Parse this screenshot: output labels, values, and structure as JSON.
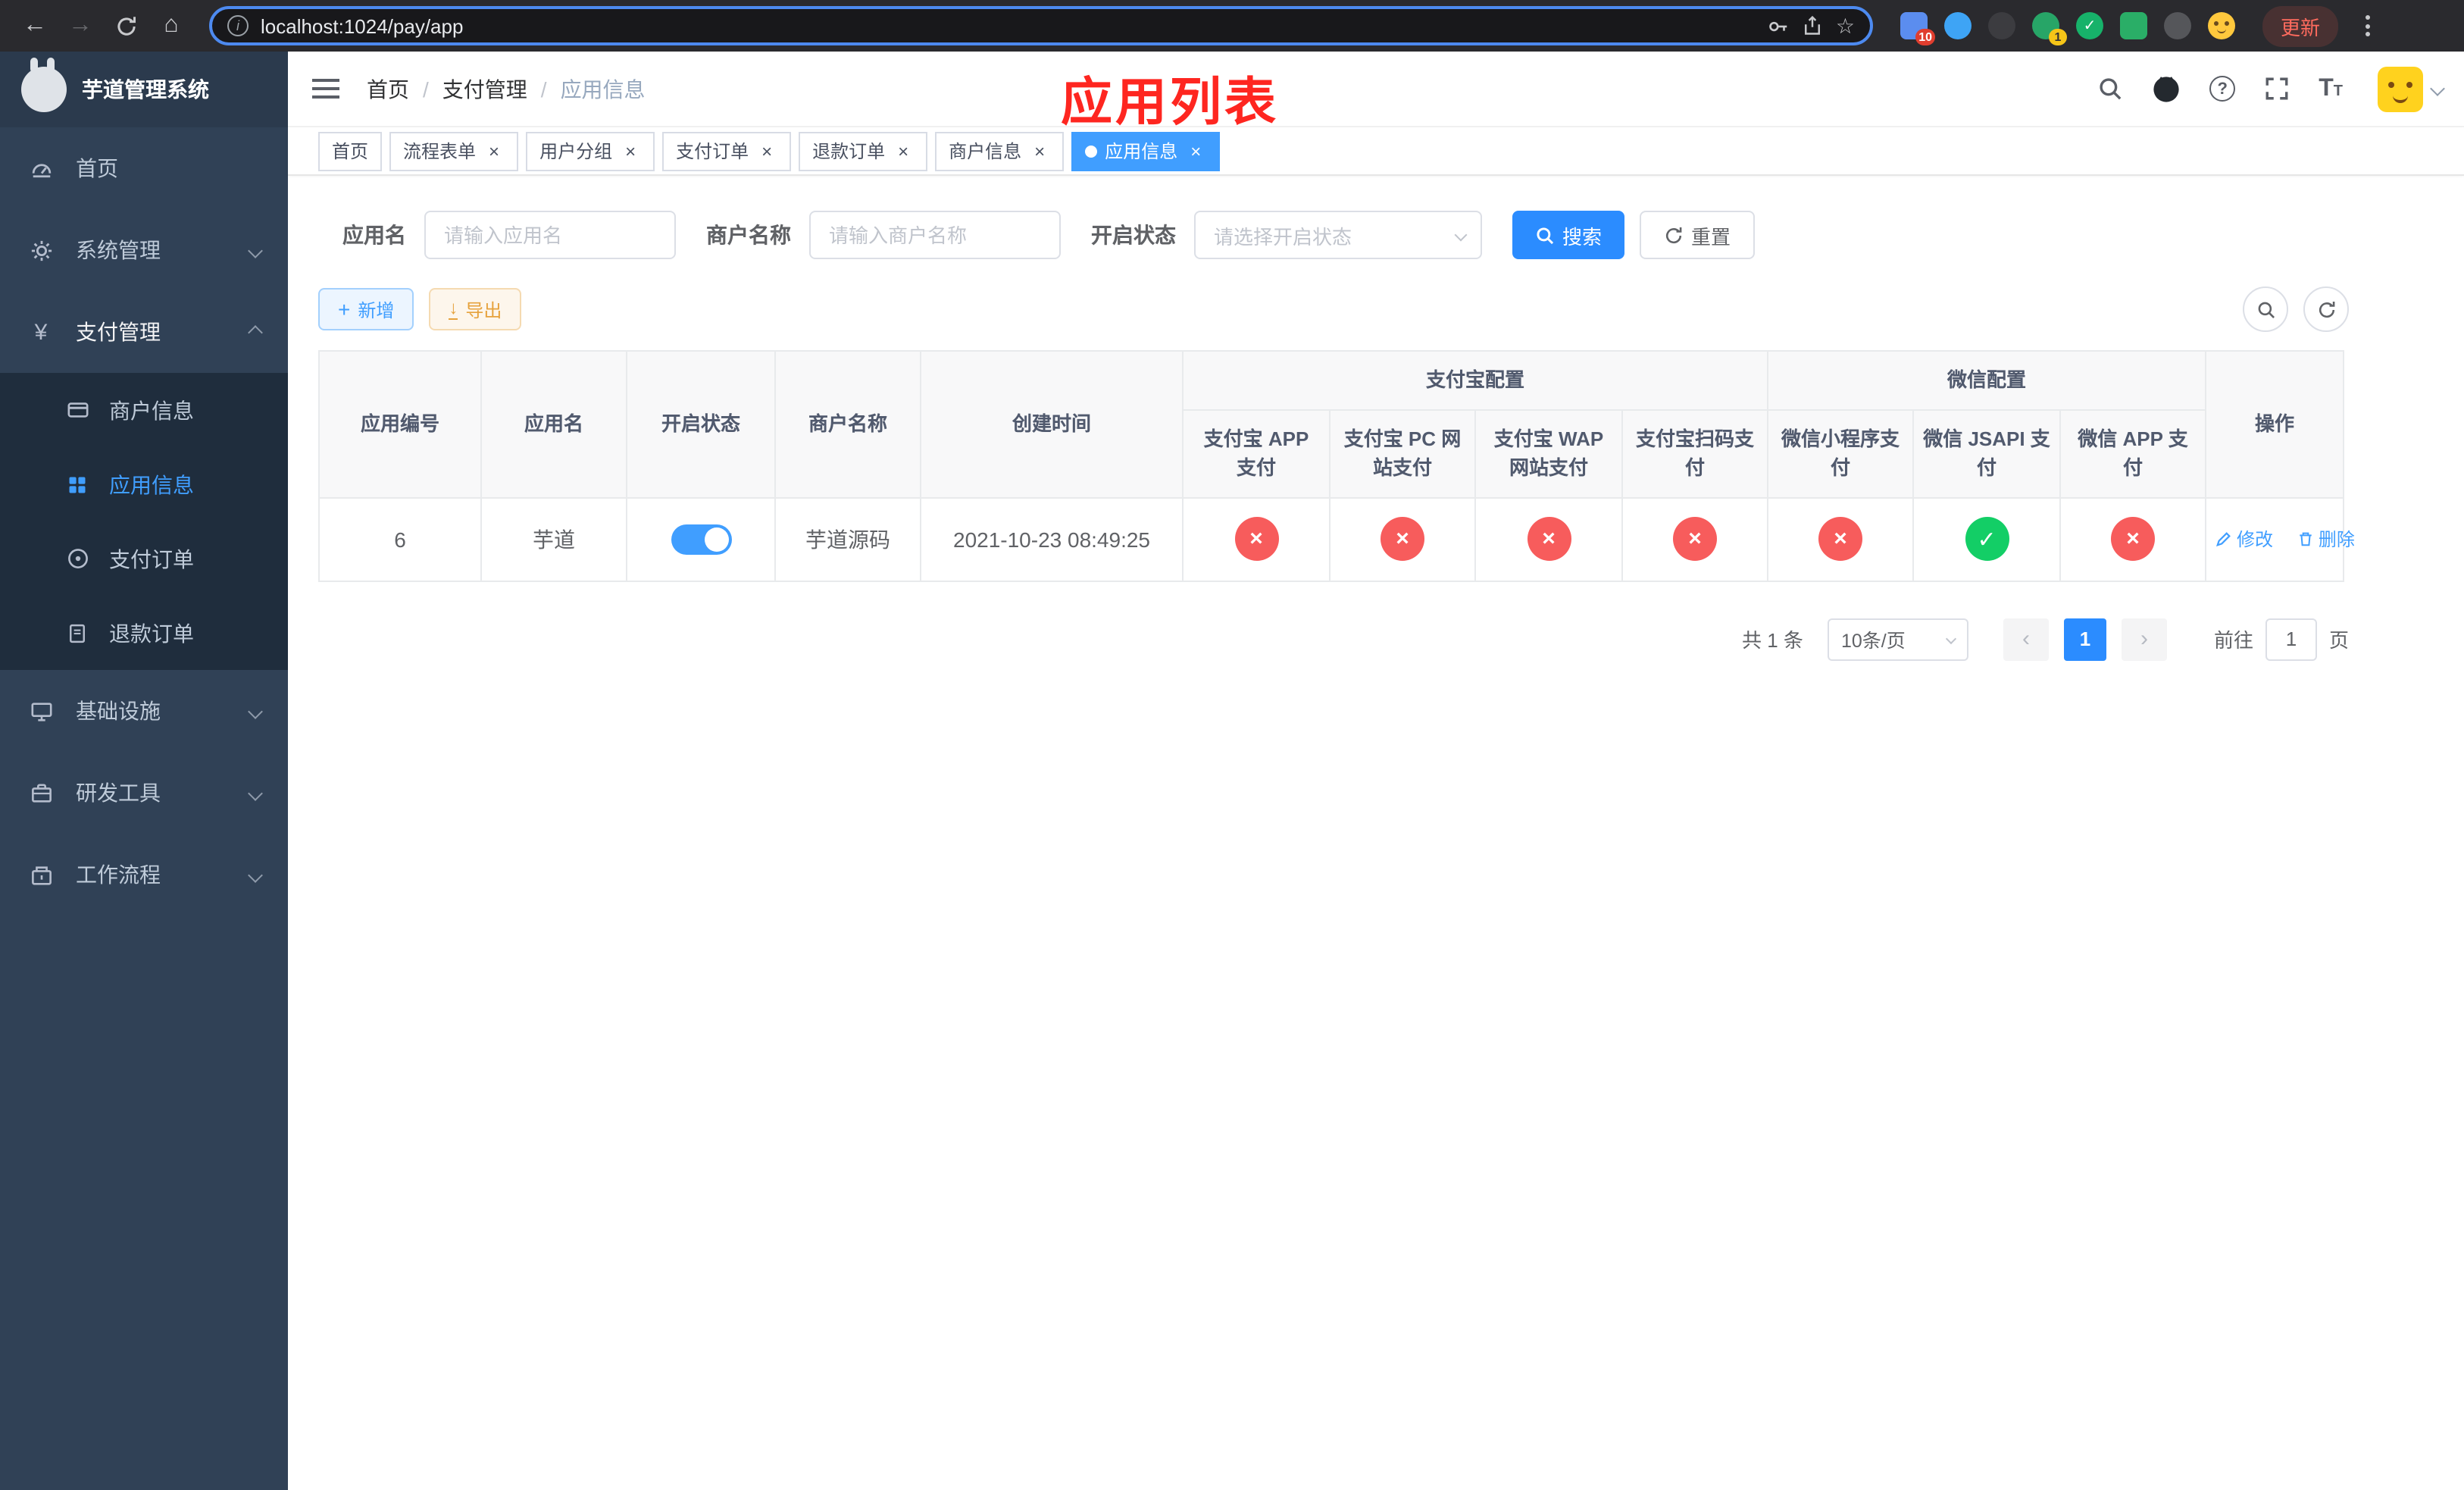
{
  "colors": {
    "accent": "#409eff",
    "primary_strong": "#2b8cff",
    "success": "#13ce66",
    "danger": "#f75c5c",
    "warning": "#e6a23c",
    "sidebar_bg": "#304156",
    "sidebar_sub_bg": "#1f2d3d",
    "annotation": "#fe2620"
  },
  "icons": {
    "back": "←",
    "forward": "→",
    "home": "⌂",
    "info": "i",
    "star": "☆",
    "close": "×",
    "check": "✓",
    "cross": "×",
    "plus": "+",
    "download": "↓",
    "prev": "‹",
    "next": "›",
    "question": "?",
    "yen": "¥",
    "slash": "/",
    "font_large": "T",
    "font_small": "T"
  },
  "browser": {
    "url": "localhost:1024/pay/app",
    "update_label": "更新",
    "puzzle_badge": "10",
    "avatar_badge": "1"
  },
  "sidebar": {
    "logo_title": "芋道管理系统",
    "items": [
      {
        "label": "首页"
      },
      {
        "label": "系统管理"
      },
      {
        "label": "支付管理"
      },
      {
        "label": "基础设施"
      },
      {
        "label": "研发工具"
      },
      {
        "label": "工作流程"
      }
    ],
    "payment_children": [
      {
        "label": "商户信息"
      },
      {
        "label": "应用信息",
        "active": true
      },
      {
        "label": "支付订单"
      },
      {
        "label": "退款订单"
      }
    ]
  },
  "navbar": {
    "breadcrumb": [
      "首页",
      "支付管理",
      "应用信息"
    ]
  },
  "annotation_text": "应用列表",
  "tabs": [
    {
      "label": "首页",
      "closable": false,
      "active": false
    },
    {
      "label": "流程表单",
      "closable": true,
      "active": false
    },
    {
      "label": "用户分组",
      "closable": true,
      "active": false
    },
    {
      "label": "支付订单",
      "closable": true,
      "active": false
    },
    {
      "label": "退款订单",
      "closable": true,
      "active": false
    },
    {
      "label": "商户信息",
      "closable": true,
      "active": false
    },
    {
      "label": "应用信息",
      "closable": true,
      "active": true
    }
  ],
  "filters": {
    "app_name_label": "应用名",
    "app_name_placeholder": "请输入应用名",
    "merchant_label": "商户名称",
    "merchant_placeholder": "请输入商户名称",
    "status_label": "开启状态",
    "status_placeholder": "请选择开启状态",
    "search_label": "搜索",
    "reset_label": "重置"
  },
  "toolbar": {
    "add_label": "新增",
    "export_label": "导出"
  },
  "table": {
    "group_alipay": "支付宝配置",
    "group_wechat": "微信配置",
    "col_app_id": "应用编号",
    "col_app_name": "应用名",
    "col_status": "开启状态",
    "col_merchant": "商户名称",
    "col_created": "创建时间",
    "col_alipay_app": "支付宝 APP 支付",
    "col_alipay_pc": "支付宝 PC 网站支付",
    "col_alipay_wap": "支付宝 WAP 网站支付",
    "col_alipay_qr": "支付宝扫码支付",
    "col_wx_mini": "微信小程序支付",
    "col_wx_jsapi": "微信 JSAPI 支付",
    "col_wx_app": "微信 APP 支付",
    "col_actions": "操作",
    "row": {
      "id": "6",
      "name": "芋道",
      "enabled": true,
      "merchant": "芋道源码",
      "created_at": "2021-10-23 08:49:25",
      "configs": [
        "fail",
        "fail",
        "fail",
        "fail",
        "fail",
        "success",
        "fail"
      ],
      "edit_label": "修改",
      "delete_label": "删除"
    }
  },
  "pagination": {
    "total": "共 1 条",
    "page_size": "10条/页",
    "page": "1",
    "goto_label": "前往",
    "goto_value": "1",
    "unit_label": "页"
  }
}
